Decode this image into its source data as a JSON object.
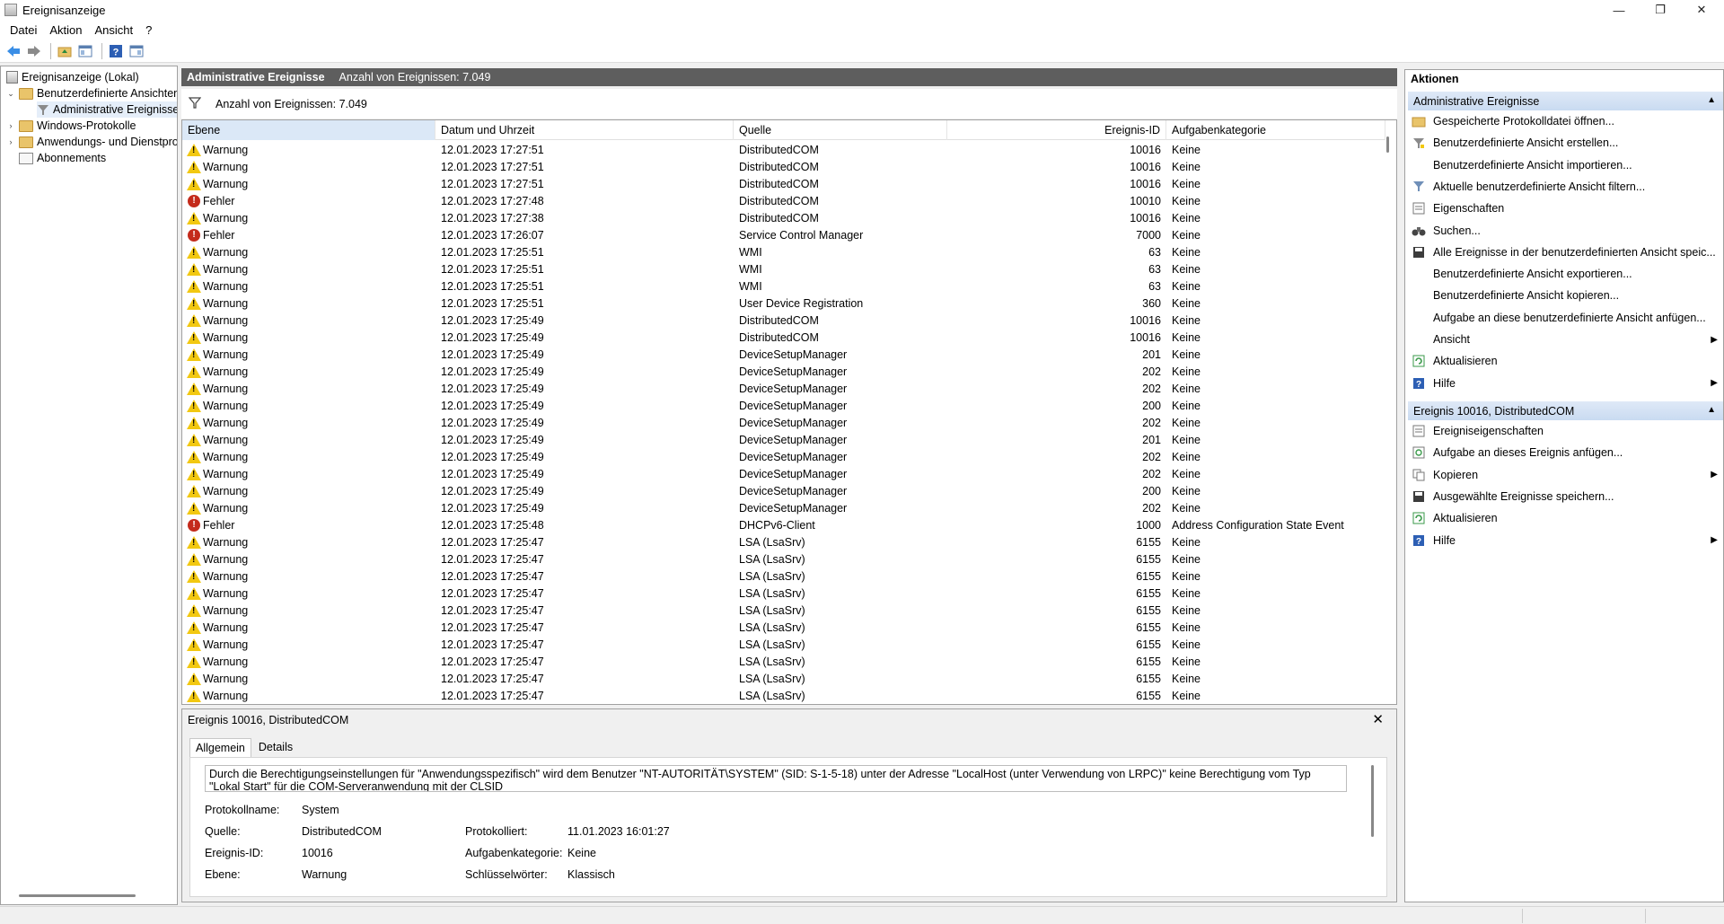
{
  "window": {
    "title": "Ereignisanzeige",
    "minimize": "—",
    "maximize": "❐",
    "close": "✕"
  },
  "menu": [
    "Datei",
    "Aktion",
    "Ansicht",
    "?"
  ],
  "tree": {
    "root": "Ereignisanzeige (Lokal)",
    "custom_views": "Benutzerdefinierte Ansichten",
    "admin_events": "Administrative Ereignisse",
    "windows_logs": "Windows-Protokolle",
    "app_service_logs": "Anwendungs- und Dienstprotokolle",
    "subscriptions": "Abonnements"
  },
  "center": {
    "title": "Administrative Ereignisse",
    "count_label": "Anzahl von Ereignissen: 7.049",
    "filter_label": "Anzahl von Ereignissen: 7.049",
    "columns": {
      "level": "Ebene",
      "datetime": "Datum und Uhrzeit",
      "source": "Quelle",
      "event_id": "Ereignis-ID",
      "category": "Aufgabenkategorie"
    },
    "rows": [
      {
        "level": "Warnung",
        "type": "warning",
        "datetime": "12.01.2023 17:27:51",
        "source": "DistributedCOM",
        "event_id": "10016",
        "category": "Keine"
      },
      {
        "level": "Warnung",
        "type": "warning",
        "datetime": "12.01.2023 17:27:51",
        "source": "DistributedCOM",
        "event_id": "10016",
        "category": "Keine"
      },
      {
        "level": "Warnung",
        "type": "warning",
        "datetime": "12.01.2023 17:27:51",
        "source": "DistributedCOM",
        "event_id": "10016",
        "category": "Keine"
      },
      {
        "level": "Fehler",
        "type": "error",
        "datetime": "12.01.2023 17:27:48",
        "source": "DistributedCOM",
        "event_id": "10010",
        "category": "Keine"
      },
      {
        "level": "Warnung",
        "type": "warning",
        "datetime": "12.01.2023 17:27:38",
        "source": "DistributedCOM",
        "event_id": "10016",
        "category": "Keine"
      },
      {
        "level": "Fehler",
        "type": "error",
        "datetime": "12.01.2023 17:26:07",
        "source": "Service Control Manager",
        "event_id": "7000",
        "category": "Keine"
      },
      {
        "level": "Warnung",
        "type": "warning",
        "datetime": "12.01.2023 17:25:51",
        "source": "WMI",
        "event_id": "63",
        "category": "Keine"
      },
      {
        "level": "Warnung",
        "type": "warning",
        "datetime": "12.01.2023 17:25:51",
        "source": "WMI",
        "event_id": "63",
        "category": "Keine"
      },
      {
        "level": "Warnung",
        "type": "warning",
        "datetime": "12.01.2023 17:25:51",
        "source": "WMI",
        "event_id": "63",
        "category": "Keine"
      },
      {
        "level": "Warnung",
        "type": "warning",
        "datetime": "12.01.2023 17:25:51",
        "source": "User Device Registration",
        "event_id": "360",
        "category": "Keine"
      },
      {
        "level": "Warnung",
        "type": "warning",
        "datetime": "12.01.2023 17:25:49",
        "source": "DistributedCOM",
        "event_id": "10016",
        "category": "Keine"
      },
      {
        "level": "Warnung",
        "type": "warning",
        "datetime": "12.01.2023 17:25:49",
        "source": "DistributedCOM",
        "event_id": "10016",
        "category": "Keine"
      },
      {
        "level": "Warnung",
        "type": "warning",
        "datetime": "12.01.2023 17:25:49",
        "source": "DeviceSetupManager",
        "event_id": "201",
        "category": "Keine"
      },
      {
        "level": "Warnung",
        "type": "warning",
        "datetime": "12.01.2023 17:25:49",
        "source": "DeviceSetupManager",
        "event_id": "202",
        "category": "Keine"
      },
      {
        "level": "Warnung",
        "type": "warning",
        "datetime": "12.01.2023 17:25:49",
        "source": "DeviceSetupManager",
        "event_id": "202",
        "category": "Keine"
      },
      {
        "level": "Warnung",
        "type": "warning",
        "datetime": "12.01.2023 17:25:49",
        "source": "DeviceSetupManager",
        "event_id": "200",
        "category": "Keine"
      },
      {
        "level": "Warnung",
        "type": "warning",
        "datetime": "12.01.2023 17:25:49",
        "source": "DeviceSetupManager",
        "event_id": "202",
        "category": "Keine"
      },
      {
        "level": "Warnung",
        "type": "warning",
        "datetime": "12.01.2023 17:25:49",
        "source": "DeviceSetupManager",
        "event_id": "201",
        "category": "Keine"
      },
      {
        "level": "Warnung",
        "type": "warning",
        "datetime": "12.01.2023 17:25:49",
        "source": "DeviceSetupManager",
        "event_id": "202",
        "category": "Keine"
      },
      {
        "level": "Warnung",
        "type": "warning",
        "datetime": "12.01.2023 17:25:49",
        "source": "DeviceSetupManager",
        "event_id": "202",
        "category": "Keine"
      },
      {
        "level": "Warnung",
        "type": "warning",
        "datetime": "12.01.2023 17:25:49",
        "source": "DeviceSetupManager",
        "event_id": "200",
        "category": "Keine"
      },
      {
        "level": "Warnung",
        "type": "warning",
        "datetime": "12.01.2023 17:25:49",
        "source": "DeviceSetupManager",
        "event_id": "202",
        "category": "Keine"
      },
      {
        "level": "Fehler",
        "type": "error",
        "datetime": "12.01.2023 17:25:48",
        "source": "DHCPv6-Client",
        "event_id": "1000",
        "category": "Address Configuration State Event"
      },
      {
        "level": "Warnung",
        "type": "warning",
        "datetime": "12.01.2023 17:25:47",
        "source": "LSA (LsaSrv)",
        "event_id": "6155",
        "category": "Keine"
      },
      {
        "level": "Warnung",
        "type": "warning",
        "datetime": "12.01.2023 17:25:47",
        "source": "LSA (LsaSrv)",
        "event_id": "6155",
        "category": "Keine"
      },
      {
        "level": "Warnung",
        "type": "warning",
        "datetime": "12.01.2023 17:25:47",
        "source": "LSA (LsaSrv)",
        "event_id": "6155",
        "category": "Keine"
      },
      {
        "level": "Warnung",
        "type": "warning",
        "datetime": "12.01.2023 17:25:47",
        "source": "LSA (LsaSrv)",
        "event_id": "6155",
        "category": "Keine"
      },
      {
        "level": "Warnung",
        "type": "warning",
        "datetime": "12.01.2023 17:25:47",
        "source": "LSA (LsaSrv)",
        "event_id": "6155",
        "category": "Keine"
      },
      {
        "level": "Warnung",
        "type": "warning",
        "datetime": "12.01.2023 17:25:47",
        "source": "LSA (LsaSrv)",
        "event_id": "6155",
        "category": "Keine"
      },
      {
        "level": "Warnung",
        "type": "warning",
        "datetime": "12.01.2023 17:25:47",
        "source": "LSA (LsaSrv)",
        "event_id": "6155",
        "category": "Keine"
      },
      {
        "level": "Warnung",
        "type": "warning",
        "datetime": "12.01.2023 17:25:47",
        "source": "LSA (LsaSrv)",
        "event_id": "6155",
        "category": "Keine"
      },
      {
        "level": "Warnung",
        "type": "warning",
        "datetime": "12.01.2023 17:25:47",
        "source": "LSA (LsaSrv)",
        "event_id": "6155",
        "category": "Keine"
      },
      {
        "level": "Warnung",
        "type": "warning",
        "datetime": "12.01.2023 17:25:47",
        "source": "LSA (LsaSrv)",
        "event_id": "6155",
        "category": "Keine"
      }
    ]
  },
  "detail": {
    "title": "Ereignis 10016, DistributedCOM",
    "close": "✕",
    "tabs": [
      "Allgemein",
      "Details"
    ],
    "message": "Durch die Berechtigungseinstellungen für \"Anwendungsspezifisch\" wird dem Benutzer \"NT-AUTORITÄT\\SYSTEM\" (SID: S-1-5-18) unter der Adresse \"LocalHost (unter Verwendung von LRPC)\" keine Berechtigung vom Typ \"Lokal Start\" für die COM-Serveranwendung mit der CLSID",
    "fields": {
      "log_name_label": "Protokollname:",
      "log_name": "System",
      "source_label": "Quelle:",
      "source": "DistributedCOM",
      "logged_label": "Protokolliert:",
      "logged": "11.01.2023 16:01:27",
      "event_id_label": "Ereignis-ID:",
      "event_id": "10016",
      "task_cat_label": "Aufgabenkategorie:",
      "task_cat": "Keine",
      "level_label": "Ebene:",
      "level": "Warnung",
      "keywords_label": "Schlüsselwörter:",
      "keywords": "Klassisch"
    }
  },
  "actions": {
    "header": "Aktionen",
    "section1": {
      "title": "Administrative Ereignisse",
      "items": [
        {
          "label": "Gespeicherte Protokolldatei öffnen...",
          "icon": "open-log-icon"
        },
        {
          "label": "Benutzerdefinierte Ansicht erstellen...",
          "icon": "filter-create-icon"
        },
        {
          "label": "Benutzerdefinierte Ansicht importieren...",
          "icon": ""
        },
        {
          "label": "Aktuelle benutzerdefinierte Ansicht filtern...",
          "icon": "filter-icon"
        },
        {
          "label": "Eigenschaften",
          "icon": "properties-icon"
        },
        {
          "label": "Suchen...",
          "icon": "binoculars-icon"
        },
        {
          "label": "Alle Ereignisse in der benutzerdefinierten Ansicht speic...",
          "icon": "save-icon"
        },
        {
          "label": "Benutzerdefinierte Ansicht exportieren...",
          "icon": ""
        },
        {
          "label": "Benutzerdefinierte Ansicht kopieren...",
          "icon": ""
        },
        {
          "label": "Aufgabe an diese benutzerdefinierte Ansicht anfügen...",
          "icon": ""
        },
        {
          "label": "Ansicht",
          "icon": "",
          "submenu": true
        },
        {
          "label": "Aktualisieren",
          "icon": "refresh-icon"
        },
        {
          "label": "Hilfe",
          "icon": "help-icon",
          "submenu": true
        }
      ]
    },
    "section2": {
      "title": "Ereignis 10016, DistributedCOM",
      "items": [
        {
          "label": "Ereigniseigenschaften",
          "icon": "properties-icon"
        },
        {
          "label": "Aufgabe an dieses Ereignis anfügen...",
          "icon": "task-icon"
        },
        {
          "label": "Kopieren",
          "icon": "copy-icon",
          "submenu": true
        },
        {
          "label": "Ausgewählte Ereignisse speichern...",
          "icon": "save-icon"
        },
        {
          "label": "Aktualisieren",
          "icon": "refresh-icon"
        },
        {
          "label": "Hilfe",
          "icon": "help-icon",
          "submenu": true
        }
      ]
    }
  },
  "colors": {
    "warning": "#f2c811",
    "error": "#c42b1c",
    "section_header": "#c9dbf1",
    "center_header": "#5e5e5e"
  }
}
